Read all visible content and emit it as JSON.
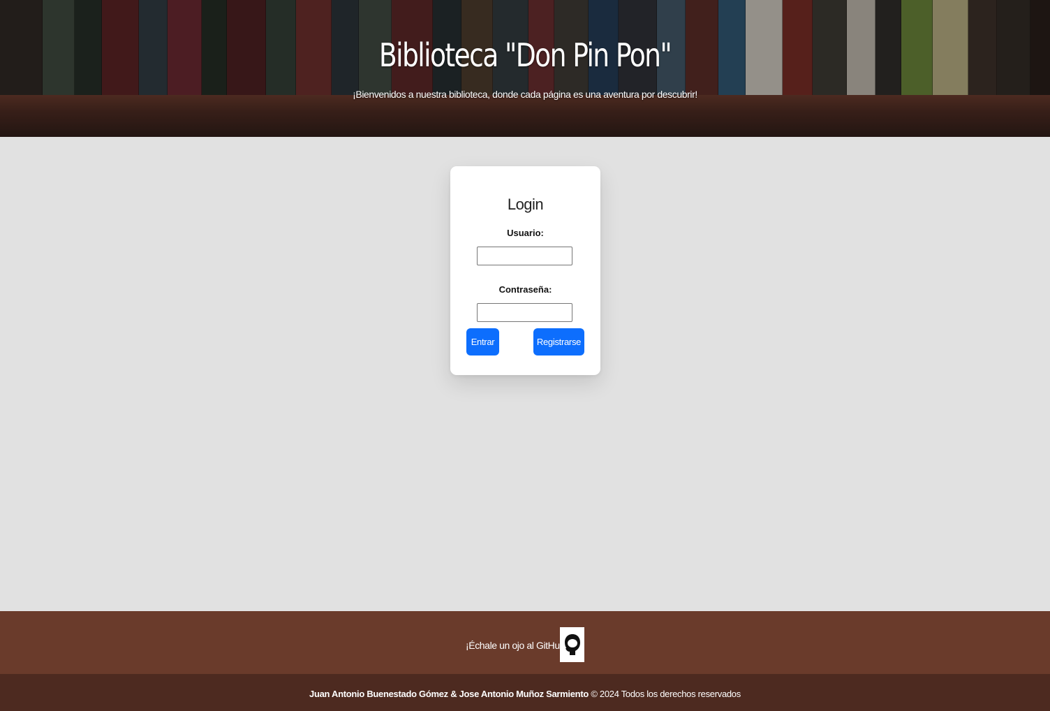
{
  "header": {
    "title": "Biblioteca \"Don Pin Pon\"",
    "subtitle": "¡Bienvenidos a nuestra biblioteca, donde cada página es una aventura por descubrir!"
  },
  "login": {
    "title": "Login",
    "user_label": "Usuario:",
    "user_value": "",
    "password_label": "Contraseña:",
    "password_value": "",
    "enter_button": "Entrar",
    "register_button": "Registrarse"
  },
  "footer": {
    "github_text": "¡Échale un ojo al GitHub!",
    "github_icon": "github-icon",
    "authors": "Juan Antonio Buenestado Gómez & Jose Antonio Muñoz Sarmiento",
    "rights": "© 2024 Todos los derechos reservados"
  },
  "colors": {
    "page_background": "#e1e1e1",
    "button_blue": "#0d6efd",
    "footer_brown": "#6a3b2b",
    "footer_dark_brown": "#4d2a20"
  }
}
